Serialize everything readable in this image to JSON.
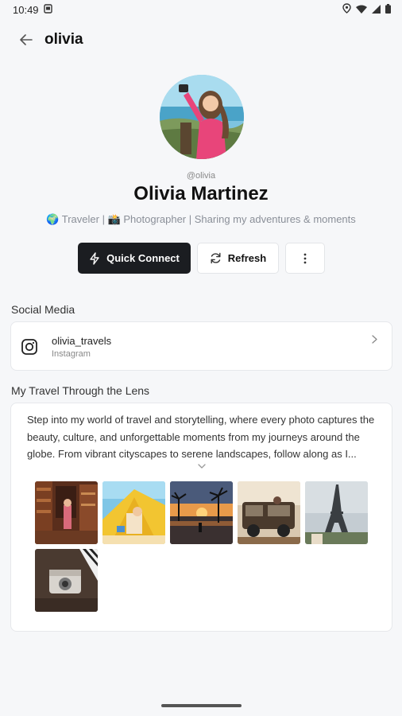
{
  "status": {
    "time": "10:49",
    "icons": [
      "sim-card-icon",
      "location-icon",
      "wifi-icon",
      "signal-icon",
      "battery-icon"
    ]
  },
  "header": {
    "title": "olivia",
    "back_icon": "arrow-left-icon"
  },
  "profile": {
    "handle": "@olivia",
    "name": "Olivia Martinez",
    "bio": "🌍 Traveler | 📸 Photographer | Sharing my adventures & moments"
  },
  "actions": {
    "quick_connect_label": "Quick Connect",
    "refresh_label": "Refresh",
    "more_icon": "more-vertical-icon"
  },
  "social": {
    "section_title": "Social Media",
    "items": [
      {
        "handle": "olivia_travels",
        "platform": "Instagram",
        "icon": "instagram-icon"
      }
    ]
  },
  "travel": {
    "section_title": "My Travel Through the Lens",
    "description": "Step into my world of travel and storytelling, where every photo captures the beauty, culture, and unforgettable moments from my journeys around the globe. From vibrant cityscapes to serene landscapes, follow along as I...",
    "photos": [
      "library-photo",
      "beach-tent-photo",
      "sunset-palms-photo",
      "safari-jeep-photo",
      "eiffel-tower-photo",
      "camera-photo"
    ]
  },
  "colors": {
    "primary_button": "#1b1d21",
    "background": "#f6f7f9",
    "card": "#ffffff"
  }
}
